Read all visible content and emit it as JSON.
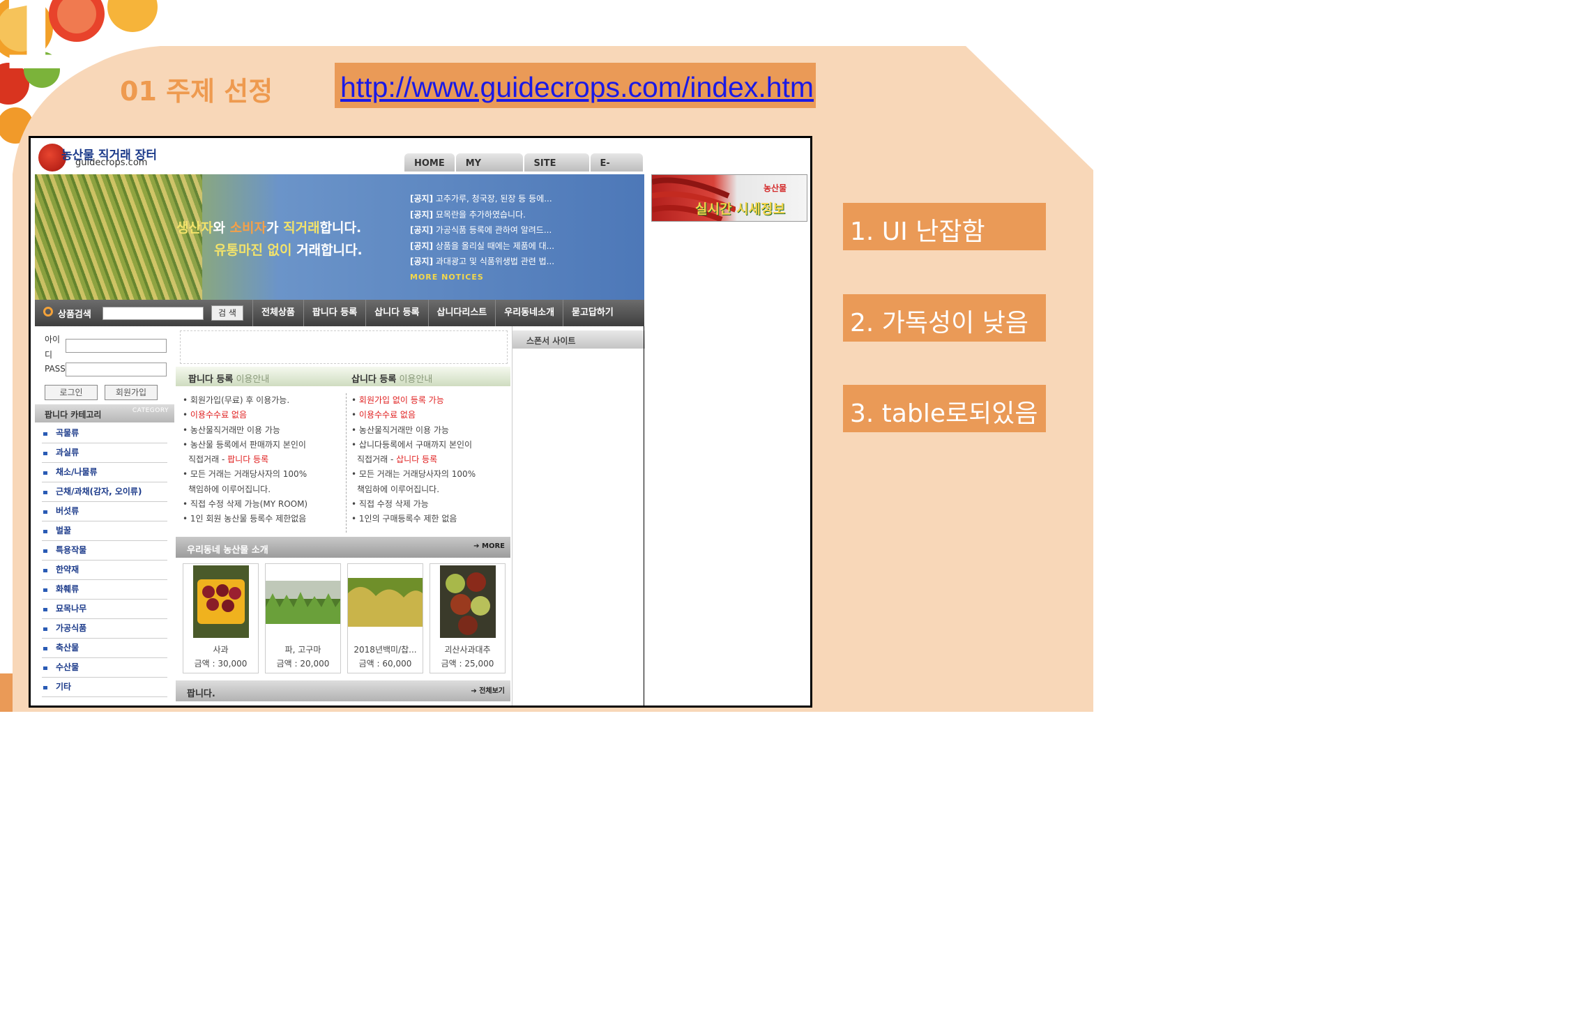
{
  "slide": {
    "number": "1",
    "title": "01 주제 선정",
    "url": "http://www.guidecrops.com/index.htm",
    "notes": [
      "1. UI 난잡함",
      "2. 가독성이 낮음",
      "3. table로되있음"
    ],
    "colors": {
      "accent": "#ea9a57",
      "background": "#f8d7b8",
      "link": "#1a1ae6"
    }
  },
  "site": {
    "logo_title": "농산물 직거래 장터",
    "logo_sub": "guidecrops.com",
    "top_nav": [
      "HOME",
      "MY ROOM",
      "SITE MAP",
      "E-MAIL"
    ],
    "banner": {
      "line1_a": "생산자",
      "line1_b": "와 ",
      "line1_c": "소비자",
      "line1_d": "가 ",
      "line1_e": "직거래",
      "line1_f": "합니다.",
      "line2_a": "유통마진 없이",
      "line2_b": " 거래합니다.",
      "notices": [
        {
          "tag": "[공지]",
          "text": " 고추가루, 청국장, 된장 등 등에..."
        },
        {
          "tag": "[공지]",
          "text": " 묘목란을 추가하였습니다."
        },
        {
          "tag": "[공지]",
          "text": " 가공식품 등록에 관하여 알려드..."
        },
        {
          "tag": "[공지]",
          "text": " 상품을 올리실 때에는 제품에 대..."
        },
        {
          "tag": "[공지]",
          "text": " 과대광고 및 식품위생법 관련 법..."
        }
      ],
      "more_notices": "MORE NOTICES"
    },
    "search": {
      "label": "상품검색",
      "button": "검 색"
    },
    "main_nav": [
      "전체상품",
      "팝니다 등록",
      "삽니다 등록",
      "삽니다리스트",
      "우리동네소개",
      "묻고답하기"
    ],
    "login": {
      "id_label_1": "아이",
      "id_label_2": "디",
      "pass_label": "PASS",
      "login_button": "로그인",
      "join_button": "회원가입"
    },
    "category": {
      "title": "팝니다 카테고리",
      "title_en": "CATEGORY",
      "items": [
        "곡물류",
        "과실류",
        "채소/나물류",
        "근채/과채(감자, 오이류)",
        "버섯류",
        "벌꿀",
        "특용작물",
        "한약재",
        "화훼류",
        "묘목나무",
        "가공식품",
        "축산물",
        "수산물",
        "기타"
      ]
    },
    "guide": {
      "sell_title": "팝니다 등록",
      "sell_sub": " 이용안내",
      "buy_title": "삽니다 등록",
      "buy_sub": " 이용안내",
      "sell_lines": [
        {
          "text": "회원가입(무료) 후 이용가능.",
          "red": ""
        },
        {
          "text": "",
          "red": "이용수수료 없음"
        },
        {
          "text": "농산물직거래만 이용 가능",
          "red": ""
        },
        {
          "text": "농산물 등록에서 판매까지 본인이",
          "red": ""
        },
        {
          "text": "직접거래 - ",
          "red": "팝니다 등록"
        },
        {
          "text": "모든 거래는 거래당사자의 100%",
          "red": ""
        },
        {
          "text": "책임하에 이루어집니다.",
          "red": ""
        },
        {
          "text": "직접 수정 삭제 가능(MY ROOM)",
          "red": ""
        },
        {
          "text": "1인 회원 농산물 등록수 제한없음",
          "red": ""
        }
      ],
      "buy_lines": [
        {
          "text": "",
          "red": "회원가입 없이 등록 가능"
        },
        {
          "text": "",
          "red": "이용수수료 없음"
        },
        {
          "text": "농산물직거래만 이용 가능",
          "red": ""
        },
        {
          "text": "삽니다등록에서 구매까지 본인이",
          "red": ""
        },
        {
          "text": "직접거래 - ",
          "red": "삽니다 등록"
        },
        {
          "text": "모든 거래는 거래당사자의 100%",
          "red": ""
        },
        {
          "text": "책임하에 이루어집니다.",
          "red": ""
        },
        {
          "text": "직접 수정 삭제 가능",
          "red": ""
        },
        {
          "text": "1인의 구매등록수 제한 없음",
          "red": ""
        }
      ]
    },
    "local": {
      "title": "우리동네 농산물 소개",
      "more": "MORE",
      "products": [
        {
          "name": "사과",
          "price": "금액 : 30,000"
        },
        {
          "name": "파, 고구마",
          "price": "금액 : 20,000"
        },
        {
          "name": "2018년백미/찹...",
          "price": "금액 : 60,000"
        },
        {
          "name": "괴산사과대추",
          "price": "금액 : 25,000"
        }
      ]
    },
    "sell_section": {
      "title": "팝니다.",
      "more": "전체보기"
    },
    "sponsor": "스폰서 사이트",
    "price_banner": {
      "small": "농산물",
      "big": "실시간 시세정보"
    }
  }
}
